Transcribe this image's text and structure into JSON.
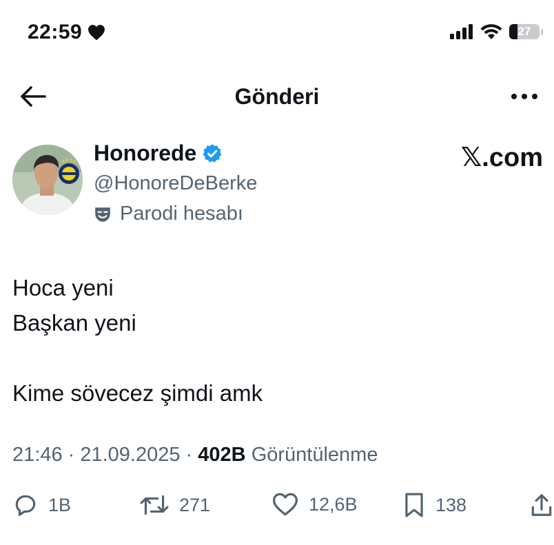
{
  "status_bar": {
    "time": "22:59",
    "battery": "27"
  },
  "header": {
    "title": "Gönderi"
  },
  "author": {
    "display_name": "Honorede",
    "handle": "@HonoreDeBerke",
    "label": "Parodi hesabı",
    "watermark": "𝕏.com"
  },
  "tweet": {
    "lines": [
      "Hoca yeni",
      "Başkan yeni",
      "",
      "Kime sövecez şimdi amk"
    ]
  },
  "meta": {
    "time": "21:46",
    "sep1": " · ",
    "date": "21.09.2025",
    "sep2": " · ",
    "views": "402B",
    "views_label": "Görüntülenme"
  },
  "actions": {
    "replies": "1B",
    "retweets": "271",
    "likes": "12,6B",
    "bookmarks": "138"
  },
  "colors": {
    "text": "#0f1419",
    "secondary": "#536471",
    "verified": "#1d9bf0"
  },
  "icons": [
    "heart-icon",
    "signal-icon",
    "wifi-icon",
    "battery-icon",
    "back-arrow-icon",
    "more-icon",
    "verified-badge-icon",
    "parody-mask-icon",
    "reply-icon",
    "retweet-icon",
    "like-icon",
    "bookmark-icon",
    "share-icon"
  ]
}
